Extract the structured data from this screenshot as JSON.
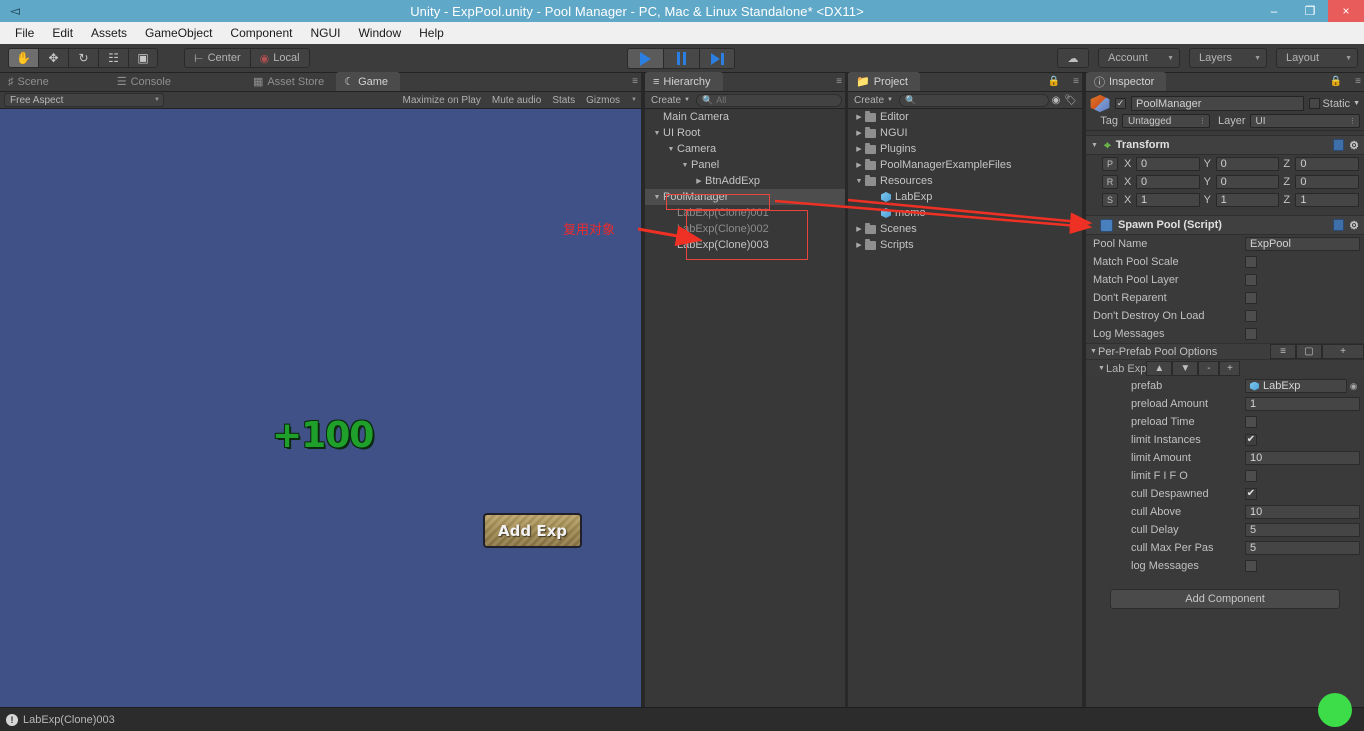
{
  "window": {
    "title": "Unity - ExpPool.unity - Pool Manager - PC, Mac & Linux Standalone* <DX11>",
    "minimize": "–",
    "maximize": "❐",
    "close": "×",
    "sysicon": "unity-logo-icon"
  },
  "menu": {
    "items": [
      "File",
      "Edit",
      "Assets",
      "GameObject",
      "Component",
      "NGUI",
      "Window",
      "Help"
    ]
  },
  "toolbar": {
    "transform_tools": [
      {
        "name": "hand-tool",
        "glyph": "✋",
        "active": true
      },
      {
        "name": "move-tool",
        "glyph": "✥",
        "active": false
      },
      {
        "name": "rotate-tool",
        "glyph": "↻",
        "active": false
      },
      {
        "name": "scale-tool",
        "glyph": "⧉",
        "active": false
      },
      {
        "name": "rect-tool",
        "glyph": "▣",
        "active": false
      }
    ],
    "pivot_label": "Center",
    "local_label": "Local",
    "play_label": "play-icon",
    "pause_label": "pause-icon",
    "step_label": "step-icon",
    "cloud_label": "cloud-icon",
    "account_label": "Account",
    "layers_label": "Layers",
    "layout_label": "Layout",
    "arrow": "▼"
  },
  "game_panel": {
    "tabs": [
      {
        "label": "Scene",
        "icon": "grid-icon",
        "selected": false
      },
      {
        "label": "Console",
        "icon": "console-icon",
        "selected": false
      },
      {
        "label": "Asset Store",
        "icon": "store-icon",
        "selected": false
      },
      {
        "label": "Game",
        "icon": "gamepad-icon",
        "selected": true
      }
    ],
    "aspect": "Free Aspect",
    "maximize_on_play": "Maximize on Play",
    "mute_audio": "Mute audio",
    "stats": "Stats",
    "gizmos": "Gizmos",
    "exp_text": "+100",
    "button_label": "Add Exp"
  },
  "hierarchy": {
    "tab_label": "Hierarchy",
    "create_label": "Create",
    "search_placeholder": "All",
    "search_value": "",
    "items": [
      {
        "label": "Main Camera",
        "depth": 0,
        "arrow": "none",
        "selected": false,
        "dim": false
      },
      {
        "label": "UI Root",
        "depth": 0,
        "arrow": "down",
        "selected": false,
        "dim": false
      },
      {
        "label": "Camera",
        "depth": 1,
        "arrow": "down",
        "selected": false,
        "dim": false
      },
      {
        "label": "Panel",
        "depth": 2,
        "arrow": "down",
        "selected": false,
        "dim": false
      },
      {
        "label": "BtnAddExp",
        "depth": 3,
        "arrow": "right",
        "selected": false,
        "dim": false
      },
      {
        "label": "PoolManager",
        "depth": 0,
        "arrow": "down",
        "selected": true,
        "dim": false
      },
      {
        "label": "LabExp(Clone)001",
        "depth": 1,
        "arrow": "none",
        "selected": false,
        "dim": true
      },
      {
        "label": "LabExp(Clone)002",
        "depth": 1,
        "arrow": "none",
        "selected": false,
        "dim": true
      },
      {
        "label": "LabExp(Clone)003",
        "depth": 1,
        "arrow": "none",
        "selected": false,
        "dim": false
      }
    ]
  },
  "project": {
    "tab_label": "Project",
    "create_label": "Create",
    "search_placeholder": "",
    "search_value": "",
    "items": [
      {
        "label": "Editor",
        "type": "folder",
        "depth": 0,
        "arrow": "right"
      },
      {
        "label": "NGUI",
        "type": "folder",
        "depth": 0,
        "arrow": "right"
      },
      {
        "label": "Plugins",
        "type": "folder",
        "depth": 0,
        "arrow": "right"
      },
      {
        "label": "PoolManagerExampleFiles",
        "type": "folder",
        "depth": 0,
        "arrow": "right"
      },
      {
        "label": "Resources",
        "type": "folder",
        "depth": 0,
        "arrow": "down"
      },
      {
        "label": "LabExp",
        "type": "prefab",
        "depth": 1,
        "arrow": "none"
      },
      {
        "label": "momo",
        "type": "prefab",
        "depth": 1,
        "arrow": "none"
      },
      {
        "label": "Scenes",
        "type": "folder",
        "depth": 0,
        "arrow": "right"
      },
      {
        "label": "Scripts",
        "type": "folder",
        "depth": 0,
        "arrow": "right"
      }
    ]
  },
  "inspector": {
    "tab_label": "Inspector",
    "object_name": "PoolManager",
    "object_enabled": true,
    "static_label": "Static",
    "tag_label": "Tag",
    "tag_value": "Untagged",
    "layer_label": "Layer",
    "layer_value": "UI",
    "transform": {
      "title": "Transform",
      "rows": [
        {
          "badge": "P",
          "x": "0",
          "y": "0",
          "z": "0"
        },
        {
          "badge": "R",
          "x": "0",
          "y": "0",
          "z": "0"
        },
        {
          "badge": "S",
          "x": "1",
          "y": "1",
          "z": "1"
        }
      ],
      "axis_labels": [
        "X",
        "Y",
        "Z"
      ]
    },
    "spawn_pool": {
      "title": "Spawn Pool (Script)",
      "fields": [
        {
          "label": "Pool Name",
          "type": "text",
          "value": "ExpPool"
        },
        {
          "label": "Match Pool Scale",
          "type": "checkbox",
          "checked": false
        },
        {
          "label": "Match Pool Layer",
          "type": "checkbox",
          "checked": false
        },
        {
          "label": "Don't Reparent",
          "type": "checkbox",
          "checked": false
        },
        {
          "label": "Don't Destroy On Load",
          "type": "checkbox",
          "checked": false
        },
        {
          "label": "Log Messages",
          "type": "checkbox",
          "checked": false
        }
      ],
      "options_title": "Per-Prefab Pool Options",
      "options_buttons": [
        "≡",
        "▢",
        "+"
      ],
      "group_title": "Lab Exp",
      "group_buttons": [
        "▲",
        "▼",
        "-",
        "+"
      ],
      "group_fields": [
        {
          "label": "prefab",
          "type": "object",
          "value": "LabExp"
        },
        {
          "label": "preload Amount",
          "type": "text",
          "value": "1"
        },
        {
          "label": "preload Time",
          "type": "checkbox",
          "checked": false
        },
        {
          "label": "limit Instances",
          "type": "checkbox",
          "checked": true
        },
        {
          "label": "limit Amount",
          "type": "text",
          "value": "10"
        },
        {
          "label": "limit F I F O",
          "type": "checkbox",
          "checked": false
        },
        {
          "label": "cull Despawned",
          "type": "checkbox",
          "checked": true
        },
        {
          "label": "cull Above",
          "type": "text",
          "value": "10"
        },
        {
          "label": "cull Delay",
          "type": "text",
          "value": "5"
        },
        {
          "label": "cull Max Per Pas",
          "type": "text",
          "value": "5"
        },
        {
          "label": "log Messages",
          "type": "checkbox",
          "checked": false
        }
      ]
    },
    "add_component_label": "Add Component"
  },
  "status": {
    "message": "LabExp(Clone)003",
    "icon": "warning-icon"
  },
  "annotations": {
    "reuse_label": "复用对象",
    "color": "#ee2b2b"
  },
  "colors": {
    "title_bar": "#5fa8c8",
    "menu_bar": "#f0f0f0",
    "panel_bg": "#383838",
    "game_bg": "#3f5187",
    "accent_play": "#2a7fe0",
    "exp_green": "#1fa02a",
    "button_gold": "#9d874f",
    "annotation_red": "#ee2b2b",
    "status_green": "#3ddc49"
  }
}
